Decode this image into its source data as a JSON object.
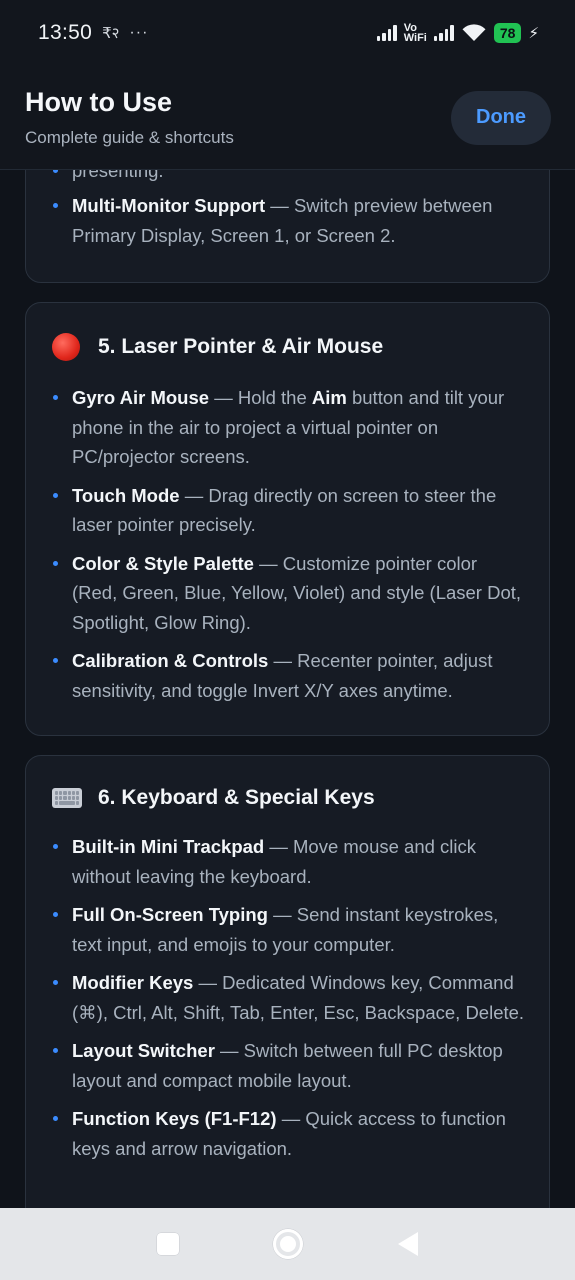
{
  "status_bar": {
    "time": "13:50",
    "rupee": "₹२",
    "dots": "···",
    "vo": "Vo",
    "wifi_label": "WiFi",
    "battery": "78",
    "bolt": "⚡"
  },
  "header": {
    "title": "How to Use",
    "subtitle": "Complete guide & shortcuts",
    "done_label": "Done"
  },
  "section4": {
    "clipped_text": "presenting.",
    "items": [
      {
        "title": "Multi-Monitor Support",
        "desc": " — Switch preview between Primary Display, Screen 1, or Screen 2."
      }
    ]
  },
  "section5": {
    "icon": "red-circle-icon",
    "title": "5. Laser Pointer & Air Mouse",
    "items": [
      {
        "title": "Gyro Air Mouse",
        "desc_a": " — Hold the ",
        "bold": "Aim",
        "desc_b": " button and tilt your phone in the air to project a virtual pointer on PC/projector screens."
      },
      {
        "title": "Touch Mode",
        "desc": " — Drag directly on screen to steer the laser pointer precisely."
      },
      {
        "title": "Color & Style Palette",
        "desc": " — Customize pointer color (Red, Green, Blue, Yellow, Violet) and style (Laser Dot, Spotlight, Glow Ring)."
      },
      {
        "title": "Calibration & Controls",
        "desc": " — Recenter pointer, adjust sensitivity, and toggle Invert X/Y axes anytime."
      }
    ]
  },
  "section6": {
    "icon": "keyboard-icon",
    "title": "6. Keyboard & Special Keys",
    "items": [
      {
        "title": "Built-in Mini Trackpad",
        "desc": " — Move mouse and click without leaving the keyboard."
      },
      {
        "title": "Full On-Screen Typing",
        "desc": " — Send instant keystrokes, text input, and emojis to your computer."
      },
      {
        "title": "Modifier Keys",
        "desc": " — Dedicated Windows key, Command (⌘), Ctrl, Alt, Shift, Tab, Enter, Esc, Backspace, Delete."
      },
      {
        "title": "Layout Switcher",
        "desc": " — Switch between full PC desktop layout and compact mobile layout."
      },
      {
        "title": "Function Keys (F1-F12)",
        "desc": " — Quick access to function keys and arrow navigation."
      }
    ]
  },
  "colors": {
    "accent": "#4c9bff",
    "bullet": "#3b8cff",
    "background": "#0f131a",
    "card": "#161b24",
    "battery": "#21c253"
  }
}
